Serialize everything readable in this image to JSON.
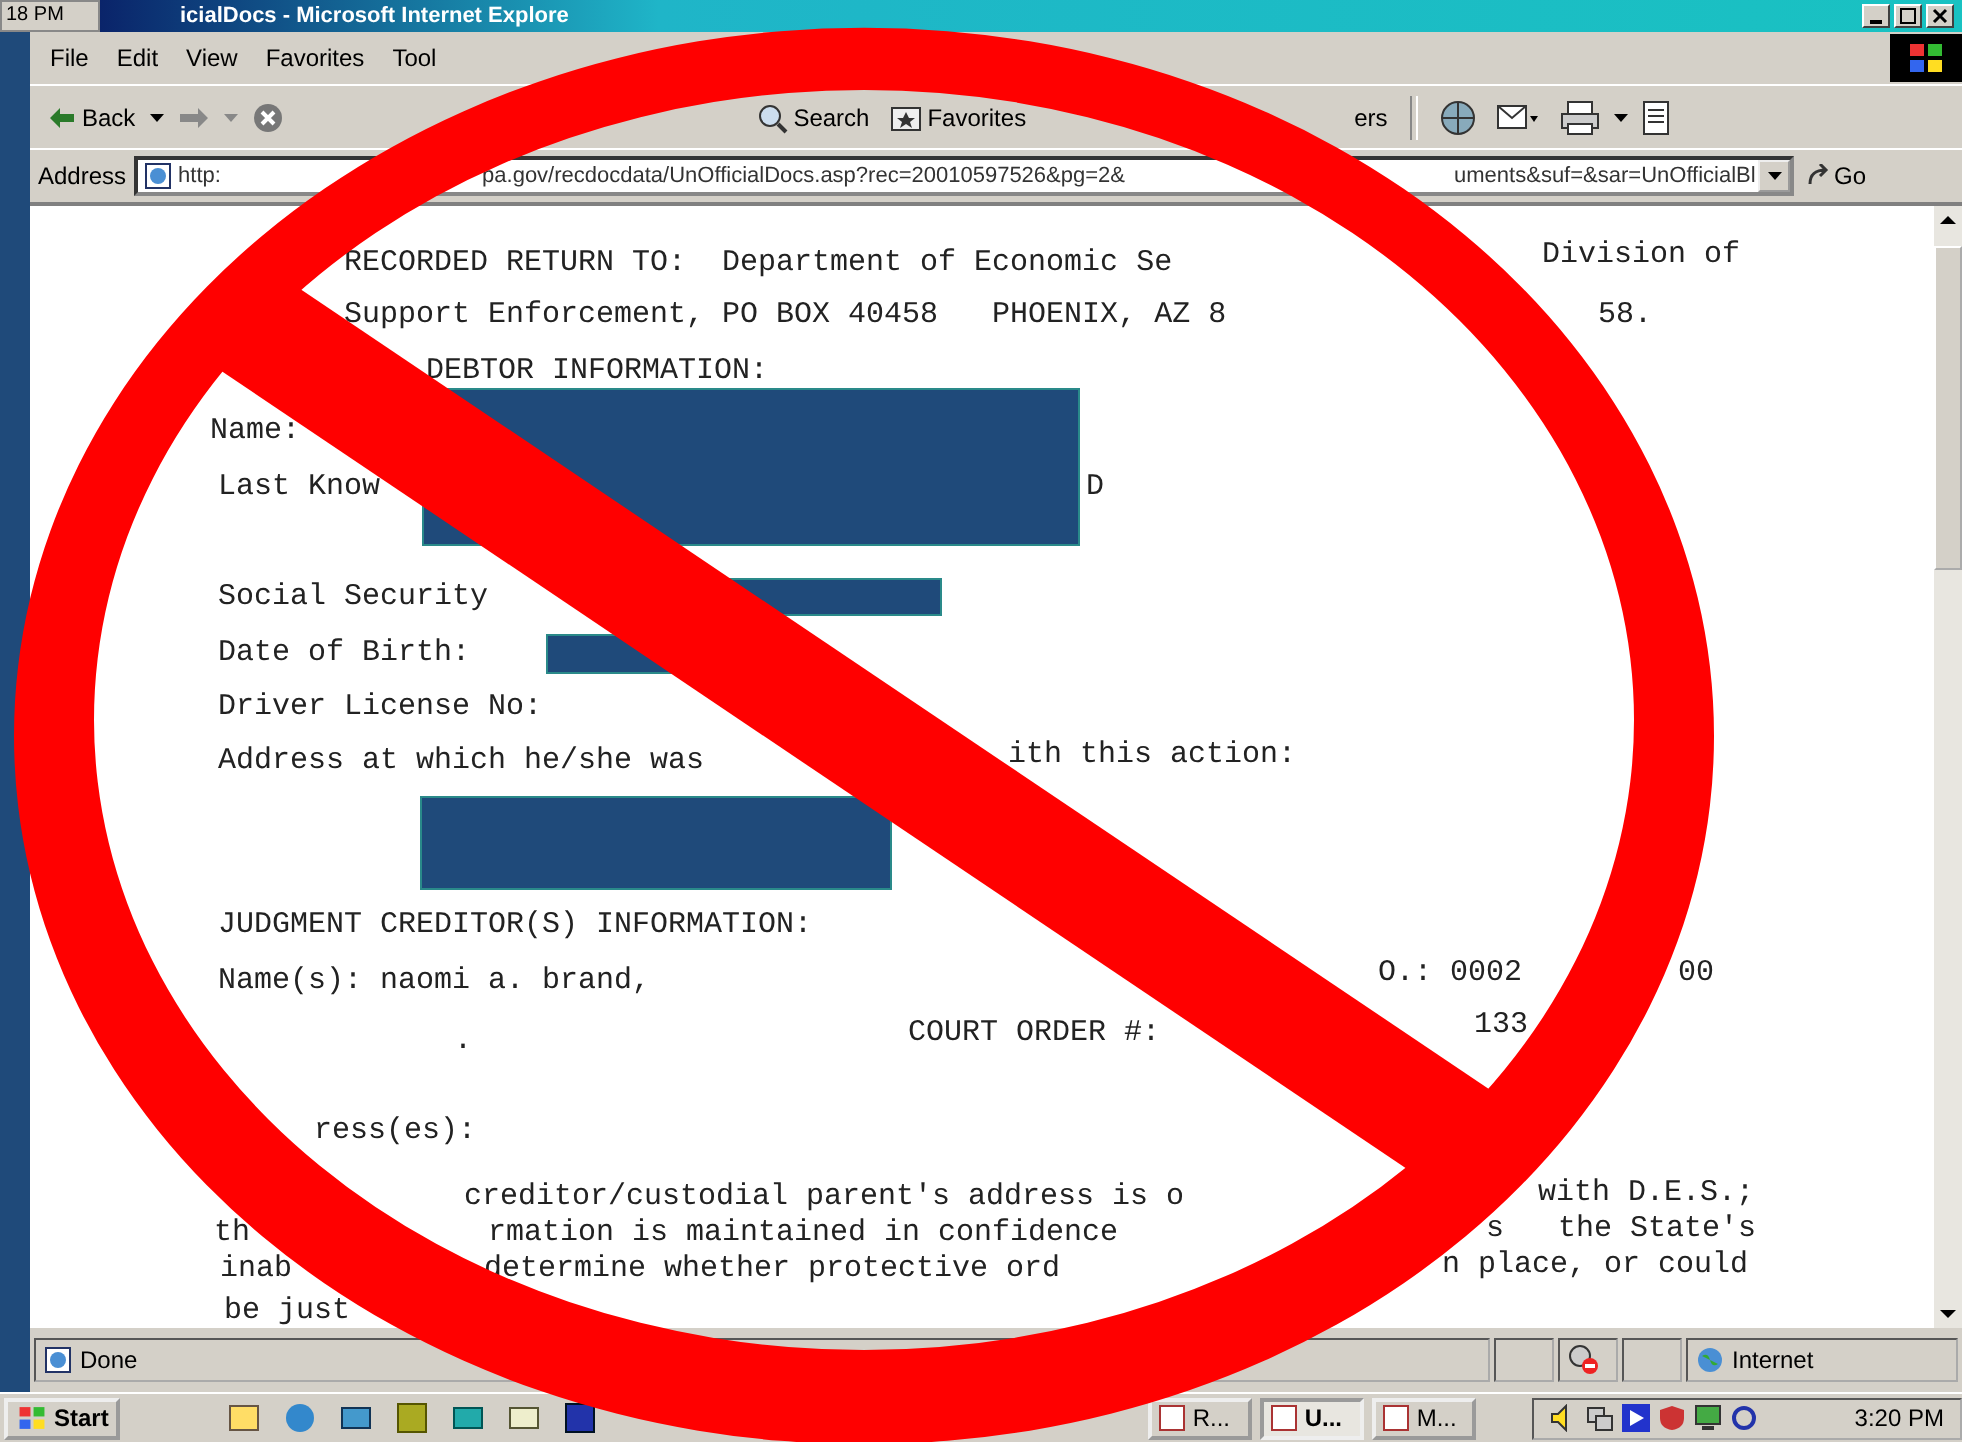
{
  "other_clock": "18 PM",
  "window": {
    "title": "icialDocs - Microsoft Internet Explore"
  },
  "menu": [
    "File",
    "Edit",
    "View",
    "Favorites",
    "Tool"
  ],
  "toolbar": {
    "back": "Back",
    "search": "Search",
    "favorites": "Favorites",
    "partial_button": "ers"
  },
  "address": {
    "label": "Address",
    "url_parts": [
      "http:",
      "pa.gov/recdocdata/UnOfficialDocs.asp?rec=20010597526&pg=2&",
      "uments&suf=&sar=UnOfficialBl"
    ],
    "go": "Go"
  },
  "document": {
    "lines": [
      {
        "fragments": [
          "RECORDED RETURN TO:  Department of Economic Se",
          "Division of"
        ]
      },
      {
        "fragments": [
          "Support Enforcement, PO BOX 40458   PHOENIX, AZ 8",
          "58."
        ]
      },
      {
        "fragments": [
          "DEBTOR INFORMATION:"
        ]
      },
      {
        "fragments": [
          "Name:"
        ]
      },
      {
        "fragments": [
          "Last Know",
          "D"
        ]
      },
      {
        "fragments": [
          "Social Security"
        ]
      },
      {
        "fragments": [
          "Date of Birth:"
        ]
      },
      {
        "fragments": [
          "Driver License No:"
        ]
      },
      {
        "fragments": [
          "Address at which he/she was",
          "ith this action:"
        ]
      },
      {
        "fragments": [
          "JUDGMENT CREDITOR(S) INFORMATION:"
        ]
      },
      {
        "fragments": [
          "Name(s): naomi a. brand,",
          "O.: 0002",
          "00"
        ]
      },
      {
        "fragments": [
          ".",
          "COURT ORDER #:",
          "133"
        ]
      },
      {
        "fragments": [
          "ress(es):"
        ]
      },
      {
        "fragments": [
          "creditor/custodial parent's address is o",
          "with D.E.S.;"
        ]
      },
      {
        "fragments": [
          "th",
          "rmation is maintained in confidence",
          "s",
          "the State's"
        ]
      },
      {
        "fragments": [
          "inab",
          "determine whether protective ord",
          "n place, or could"
        ]
      },
      {
        "fragments": [
          "be just"
        ]
      }
    ]
  },
  "status_bar": {
    "text": "Done",
    "zone": "Internet"
  },
  "taskbar": {
    "start": "Start",
    "buttons": [
      {
        "label": "R...",
        "selected": false
      },
      {
        "label": "U...",
        "selected": true
      },
      {
        "label": "M...",
        "selected": false
      }
    ],
    "clock": "3:20 PM"
  }
}
